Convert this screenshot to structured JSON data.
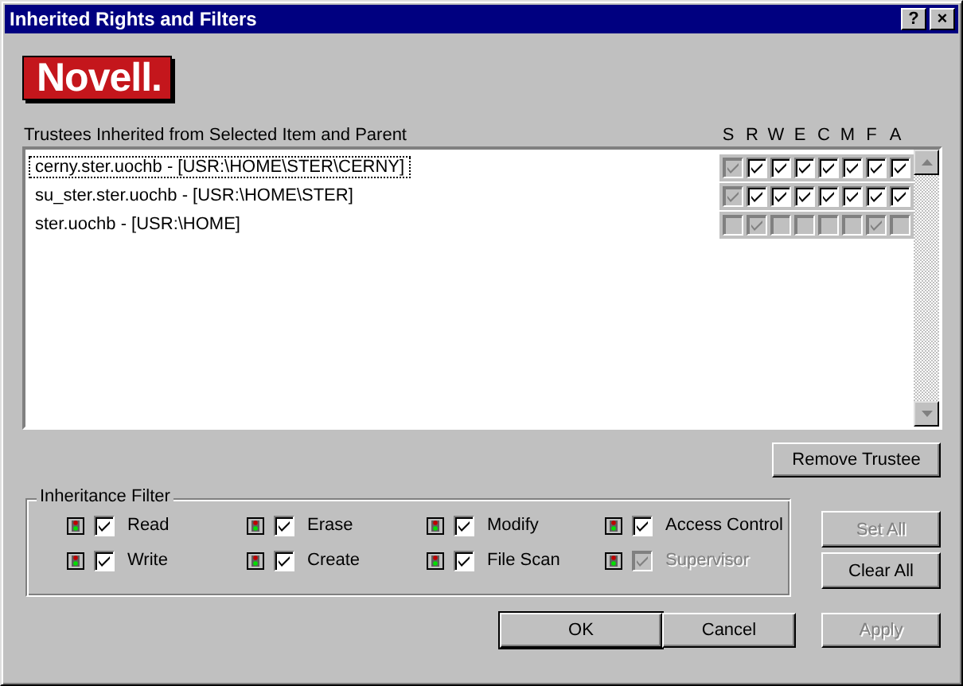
{
  "window": {
    "title": "Inherited Rights and Filters",
    "title_buttons": [
      "?",
      "×"
    ]
  },
  "logo": {
    "text": "Novell."
  },
  "trustees": {
    "label": "Trustees Inherited from Selected Item and Parent",
    "rights_headers": [
      "S",
      "R",
      "W",
      "E",
      "C",
      "M",
      "F",
      "A"
    ],
    "rows": [
      {
        "name": "cerny.ster.uochb - [USR:\\HOME\\STER\\CERNY]",
        "selected": true,
        "rights": [
          {
            "checked": true,
            "disabled": true
          },
          {
            "checked": true,
            "disabled": false
          },
          {
            "checked": true,
            "disabled": false
          },
          {
            "checked": true,
            "disabled": false
          },
          {
            "checked": true,
            "disabled": false
          },
          {
            "checked": true,
            "disabled": false
          },
          {
            "checked": true,
            "disabled": false
          },
          {
            "checked": true,
            "disabled": false
          }
        ]
      },
      {
        "name": "su_ster.ster.uochb - [USR:\\HOME\\STER]",
        "selected": false,
        "rights": [
          {
            "checked": true,
            "disabled": true
          },
          {
            "checked": true,
            "disabled": false
          },
          {
            "checked": true,
            "disabled": false
          },
          {
            "checked": true,
            "disabled": false
          },
          {
            "checked": true,
            "disabled": false
          },
          {
            "checked": true,
            "disabled": false
          },
          {
            "checked": true,
            "disabled": false
          },
          {
            "checked": true,
            "disabled": false
          }
        ]
      },
      {
        "name": "ster.uochb - [USR:\\HOME]",
        "selected": false,
        "rights": [
          {
            "checked": false,
            "disabled": true
          },
          {
            "checked": true,
            "disabled": true
          },
          {
            "checked": false,
            "disabled": true
          },
          {
            "checked": false,
            "disabled": true
          },
          {
            "checked": false,
            "disabled": true
          },
          {
            "checked": false,
            "disabled": true
          },
          {
            "checked": true,
            "disabled": true
          },
          {
            "checked": false,
            "disabled": true
          }
        ]
      }
    ]
  },
  "remove_button": {
    "label": "Remove Trustee",
    "disabled": false
  },
  "filter": {
    "title": "Inheritance Filter",
    "items": [
      {
        "label": "Read",
        "checked": true,
        "disabled": false
      },
      {
        "label": "Erase",
        "checked": true,
        "disabled": false
      },
      {
        "label": "Modify",
        "checked": true,
        "disabled": false
      },
      {
        "label": "Access Control",
        "checked": true,
        "disabled": false
      },
      {
        "label": "Write",
        "checked": true,
        "disabled": false
      },
      {
        "label": "Create",
        "checked": true,
        "disabled": false
      },
      {
        "label": "File Scan",
        "checked": true,
        "disabled": false
      },
      {
        "label": "Supervisor",
        "checked": true,
        "disabled": true
      }
    ]
  },
  "side_buttons": [
    {
      "label": "Set All",
      "disabled": true
    },
    {
      "label": "Clear All",
      "disabled": false
    }
  ],
  "buttons": [
    {
      "label": "OK",
      "disabled": false,
      "default": true
    },
    {
      "label": "Cancel",
      "disabled": false,
      "default": false
    },
    {
      "label": "Apply",
      "disabled": true,
      "default": false
    }
  ]
}
